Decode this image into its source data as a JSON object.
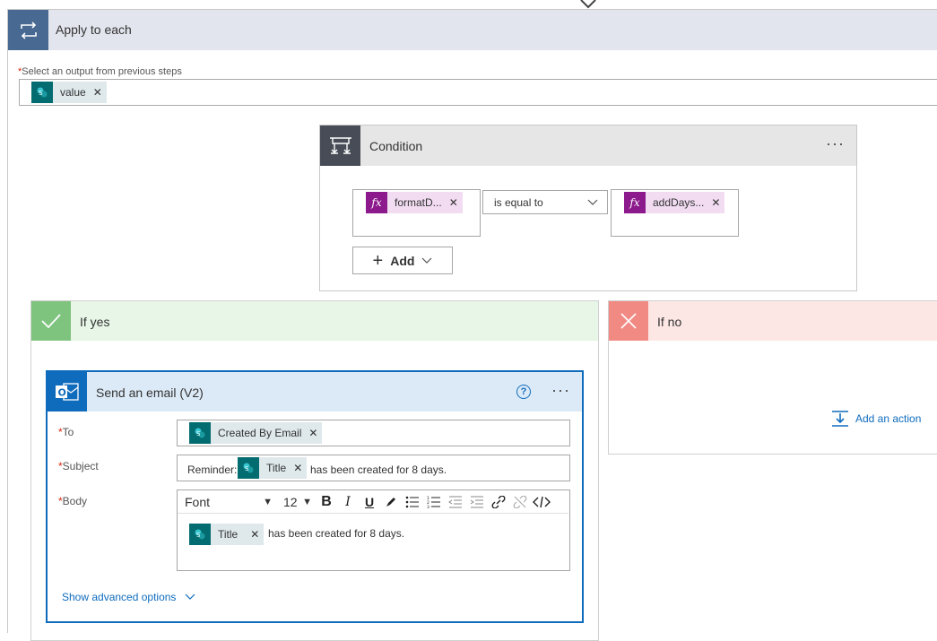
{
  "apply_to_each": {
    "title": "Apply to each",
    "select_label_required": "*",
    "select_label": "Select an output from previous steps",
    "token": "value"
  },
  "condition": {
    "title": "Condition",
    "left_token": "formatD...",
    "operator": "is equal to",
    "right_token": "addDays...",
    "add_label": "Add"
  },
  "if_yes": {
    "title": "If yes"
  },
  "if_no": {
    "title": "If no",
    "add_action": "Add an action"
  },
  "email": {
    "title": "Send an email (V2)",
    "help": "?",
    "to_label": "To",
    "to_token": "Created By Email",
    "subject_label": "Subject",
    "subject_prefix": "Reminder:",
    "subject_token": "Title",
    "subject_suffix": "has been created for 8 days.",
    "body_label": "Body",
    "font": "Font",
    "font_size": "12",
    "body_token": "Title",
    "body_text": "has been created for 8 days.",
    "show_advanced": "Show advanced options"
  },
  "colors": {
    "sharepoint": "#036c70",
    "expression": "#8c1a8c",
    "accent": "#0f6cbd",
    "yes": "#7ec37e",
    "no": "#f28a84"
  }
}
